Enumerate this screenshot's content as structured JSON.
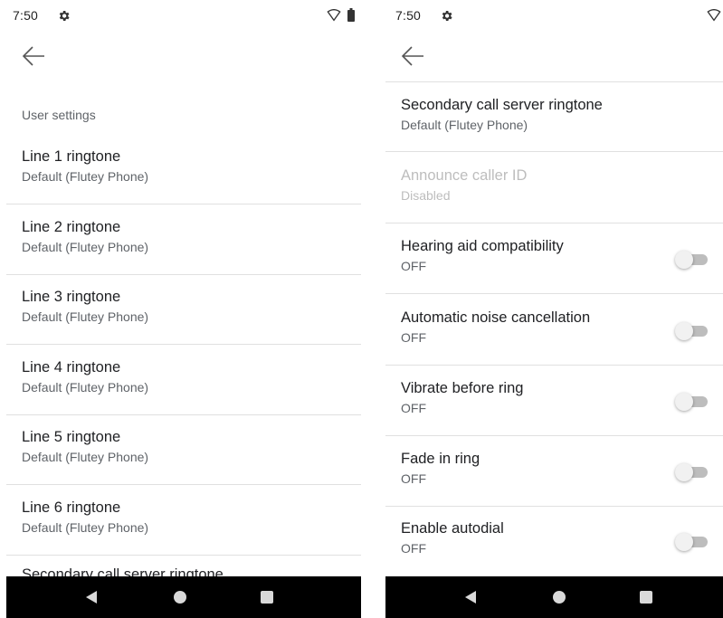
{
  "left": {
    "status": {
      "time": "7:50"
    },
    "section_header": "User settings",
    "items": [
      {
        "title": "Line 1 ringtone",
        "subtitle": "Default (Flutey Phone)"
      },
      {
        "title": "Line 2 ringtone",
        "subtitle": "Default (Flutey Phone)"
      },
      {
        "title": "Line 3 ringtone",
        "subtitle": "Default (Flutey Phone)"
      },
      {
        "title": "Line 4 ringtone",
        "subtitle": "Default (Flutey Phone)"
      },
      {
        "title": "Line 5 ringtone",
        "subtitle": "Default (Flutey Phone)"
      },
      {
        "title": "Line 6 ringtone",
        "subtitle": "Default (Flutey Phone)"
      }
    ],
    "partial_item": "Secondary call server ringtone"
  },
  "right": {
    "status": {
      "time": "7:50"
    },
    "items": [
      {
        "title": "Secondary call server ringtone",
        "subtitle": "Default (Flutey Phone)"
      },
      {
        "title": "Announce caller ID",
        "subtitle": "Disabled"
      },
      {
        "title": "Hearing aid compatibility",
        "subtitle": "OFF"
      },
      {
        "title": "Automatic noise cancellation",
        "subtitle": "OFF"
      },
      {
        "title": "Vibrate before ring",
        "subtitle": "OFF"
      },
      {
        "title": "Fade in ring",
        "subtitle": "OFF"
      },
      {
        "title": "Enable autodial",
        "subtitle": "OFF"
      }
    ]
  },
  "icons": {
    "status_settings": "gear-icon",
    "status_wifi": "wifi-icon",
    "status_battery": "battery-icon",
    "back": "arrow-left-icon",
    "nav_back": "triangle-back-icon",
    "nav_home": "circle-home-icon",
    "nav_recent": "square-recents-icon"
  },
  "colors": {
    "text_primary": "#202124",
    "text_secondary": "#5f6368",
    "disabled": "#bdbdbd",
    "divider": "#e0e0e0",
    "nav_bar": "#000000"
  }
}
